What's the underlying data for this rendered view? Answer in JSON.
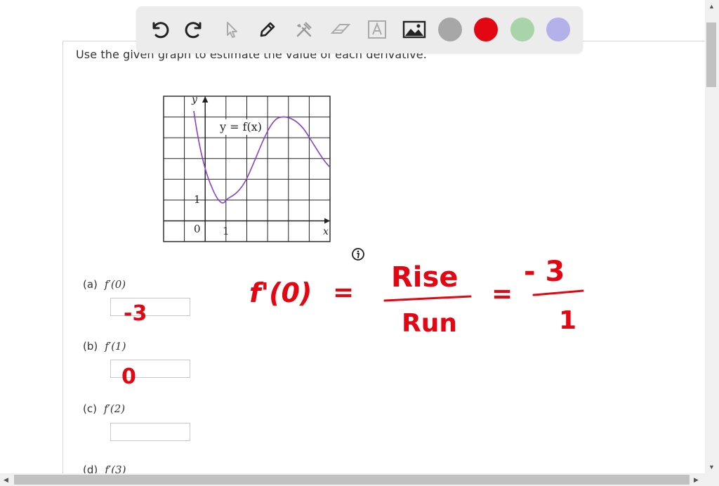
{
  "prompt": "Use the given graph to estimate the value of each derivative.",
  "toolbar": {
    "tools": [
      "undo-icon",
      "redo-icon",
      "select-pointer-icon",
      "pen-icon",
      "tools-icon",
      "eraser-icon",
      "text-icon",
      "image-icon"
    ],
    "colors": [
      "#a7a7a7",
      "#e30613",
      "#a9d3a9",
      "#b3b0ea"
    ]
  },
  "graph": {
    "curve_label": "y = f(x)",
    "y_axis_label": "y",
    "x_axis_label": "x",
    "origin_label": "0",
    "x_tick_label": "1",
    "y_tick_label": "1"
  },
  "questions": [
    {
      "letter": "(a)",
      "fn": "f′(0)",
      "answer": "-3"
    },
    {
      "letter": "(b)",
      "fn": "f′(1)",
      "answer": "0"
    },
    {
      "letter": "(c)",
      "fn": "f′(2)",
      "answer": ""
    },
    {
      "letter": "(d)",
      "fn": "f′(3)",
      "answer": ""
    }
  ],
  "handwriting": {
    "lhs": "f'(0)",
    "eq1": "=",
    "numerator": "Rise",
    "denominator": "Run",
    "eq2": "=",
    "num_value": "- 3",
    "den_value": "1"
  },
  "ink_color": "#e30613"
}
